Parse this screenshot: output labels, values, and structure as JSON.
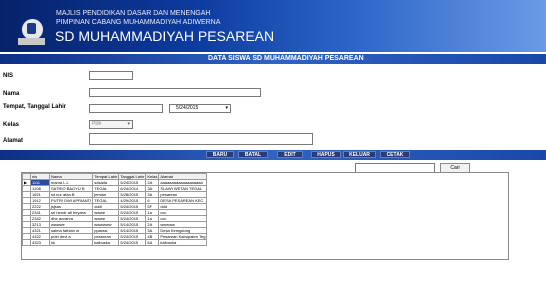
{
  "header": {
    "line1": "MAJLIS PENDIDIKAN DASAR DAN MENENGAH",
    "line2": "PIMPINAN CABANG MUHAMMADIYAH ADIWERNA",
    "title": "SD MUHAMMADIYAH PESAREAN"
  },
  "form": {
    "title": "DATA SISWA SD MUHAMMADIYAH PESAREAN",
    "nis_label": "NIS",
    "nama_label": "Nama",
    "ttl_label": "Tempat, Tanggal Lahir",
    "date_value": "5/24/2015",
    "kelas_label": "Kelas",
    "kelas_value": "Pilih",
    "alamat_label": "Alamat"
  },
  "buttons": {
    "baru": "BARU",
    "batal": "BATAL",
    "edit": "EDIT",
    "hapus": "HAPUS",
    "keluar": "KELUAR",
    "cetak": "CETAK"
  },
  "search": {
    "button": "Cari"
  },
  "table": {
    "columns": [
      "nis",
      "Nama",
      "Tempat Lahir",
      "Tanggal Lahir",
      "Kelas",
      "Alamat"
    ],
    "rows": [
      [
        "1111",
        "mama L.L",
        "sdsada",
        "5/24/2015",
        "2A",
        "aaaaaaaaaaaaaaaaaaa"
      ],
      [
        "1208",
        "SATRIO BAGYU B",
        "TEGAL",
        "6/24/2014",
        "3A",
        "SLAWI WETAN TEGAL"
      ],
      [
        "1621",
        "sit nur afan.B",
        "jemian",
        "5/28/2015",
        "3A",
        "pesarean"
      ],
      [
        "1912",
        "PUTRI DWI APRIANTI",
        "TEGAL",
        "4/29/2015",
        "6",
        "DESA PESAREAN KEC"
      ],
      [
        "2222",
        "jsjsas",
        "dddl",
        "5/24/2015",
        "5F",
        "ddd"
      ],
      [
        "2341",
        "sri hendr ati beyans",
        "wwwe",
        "5/24/2015",
        "1a",
        "ccc"
      ],
      [
        "2342",
        "dhe azzahra",
        "wwwe",
        "5/24/2015",
        "1a",
        "ccc"
      ],
      [
        "3213",
        "wwwwe",
        "wwwwww",
        "5/14/2015",
        "2A",
        "wwwww"
      ],
      [
        "4321",
        "salma fathiah m",
        "pparasi",
        "5/14/2015",
        "3A",
        "Desa Kemgdong"
      ],
      [
        "4322",
        "putri devi a",
        "pesarean",
        "5/24/2015",
        "4B",
        "Pesarean Kabupaten Teg"
      ],
      [
        "4323",
        "kk",
        "kalbuska",
        "5/24/2015",
        "6A",
        "kalbuska"
      ]
    ]
  },
  "colors": {
    "header_dark": "#06226a",
    "header_light": "#6b9be6",
    "button_bg": "#283c78"
  }
}
